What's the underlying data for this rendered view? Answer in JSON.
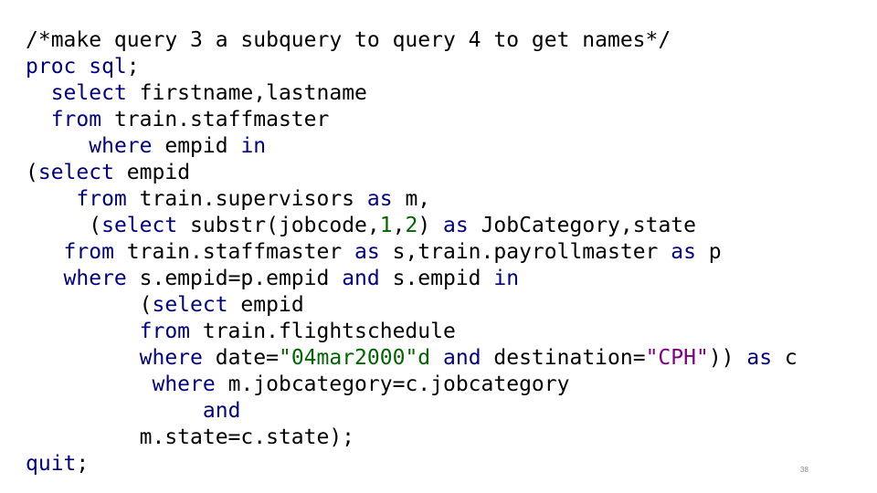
{
  "colors": {
    "keyword": "#000080",
    "string": "#800080",
    "number": "#006400",
    "text": "#000000",
    "page_number": "#8a8a8a"
  },
  "code": {
    "lines": [
      {
        "tokens": [
          {
            "text": "/*make query 3 a subquery to query 4 to get names*/",
            "type": "comment"
          }
        ]
      },
      {
        "tokens": [
          {
            "text": "proc sql",
            "type": "proc"
          },
          {
            "text": ";",
            "type": "plain"
          }
        ]
      },
      {
        "tokens": [
          {
            "text": "  ",
            "type": "plain"
          },
          {
            "text": "select",
            "type": "kw"
          },
          {
            "text": " firstname,lastname",
            "type": "plain"
          }
        ]
      },
      {
        "tokens": [
          {
            "text": "  ",
            "type": "plain"
          },
          {
            "text": "from",
            "type": "kw"
          },
          {
            "text": " train.staffmaster",
            "type": "plain"
          }
        ]
      },
      {
        "tokens": [
          {
            "text": "     ",
            "type": "plain"
          },
          {
            "text": "where",
            "type": "kw"
          },
          {
            "text": " empid ",
            "type": "plain"
          },
          {
            "text": "in",
            "type": "kw"
          }
        ]
      },
      {
        "tokens": [
          {
            "text": "(",
            "type": "plain"
          },
          {
            "text": "select",
            "type": "kw"
          },
          {
            "text": " empid",
            "type": "plain"
          }
        ]
      },
      {
        "tokens": [
          {
            "text": "    ",
            "type": "plain"
          },
          {
            "text": "from",
            "type": "kw"
          },
          {
            "text": " train.supervisors ",
            "type": "plain"
          },
          {
            "text": "as",
            "type": "kw"
          },
          {
            "text": " m,",
            "type": "plain"
          }
        ]
      },
      {
        "tokens": [
          {
            "text": "     (",
            "type": "plain"
          },
          {
            "text": "select",
            "type": "kw"
          },
          {
            "text": " substr(jobcode,",
            "type": "plain"
          },
          {
            "text": "1",
            "type": "num"
          },
          {
            "text": ",",
            "type": "plain"
          },
          {
            "text": "2",
            "type": "num"
          },
          {
            "text": ") ",
            "type": "plain"
          },
          {
            "text": "as",
            "type": "kw"
          },
          {
            "text": " JobCategory,state",
            "type": "plain"
          }
        ]
      },
      {
        "tokens": [
          {
            "text": "   ",
            "type": "plain"
          },
          {
            "text": "from",
            "type": "kw"
          },
          {
            "text": " train.staffmaster ",
            "type": "plain"
          },
          {
            "text": "as",
            "type": "kw"
          },
          {
            "text": " s,train.payrollmaster ",
            "type": "plain"
          },
          {
            "text": "as",
            "type": "kw"
          },
          {
            "text": " p",
            "type": "plain"
          }
        ]
      },
      {
        "tokens": [
          {
            "text": "   ",
            "type": "plain"
          },
          {
            "text": "where",
            "type": "kw"
          },
          {
            "text": " s.empid=p.empid ",
            "type": "plain"
          },
          {
            "text": "and",
            "type": "kw"
          },
          {
            "text": " s.empid ",
            "type": "plain"
          },
          {
            "text": "in",
            "type": "kw"
          }
        ]
      },
      {
        "tokens": [
          {
            "text": "         (",
            "type": "plain"
          },
          {
            "text": "select",
            "type": "kw"
          },
          {
            "text": " empid",
            "type": "plain"
          }
        ]
      },
      {
        "tokens": [
          {
            "text": "         ",
            "type": "plain"
          },
          {
            "text": "from",
            "type": "kw"
          },
          {
            "text": " train.flightschedule",
            "type": "plain"
          }
        ]
      },
      {
        "tokens": [
          {
            "text": "         ",
            "type": "plain"
          },
          {
            "text": "where",
            "type": "kw"
          },
          {
            "text": " date=",
            "type": "plain"
          },
          {
            "text": "\"04mar2000\"d",
            "type": "num"
          },
          {
            "text": " ",
            "type": "plain"
          },
          {
            "text": "and",
            "type": "kw"
          },
          {
            "text": " destination=",
            "type": "plain"
          },
          {
            "text": "\"CPH\"",
            "type": "str"
          },
          {
            "text": ")) ",
            "type": "plain"
          },
          {
            "text": "as",
            "type": "kw"
          },
          {
            "text": " c",
            "type": "plain"
          }
        ]
      },
      {
        "tokens": [
          {
            "text": "          ",
            "type": "plain"
          },
          {
            "text": "where",
            "type": "kw"
          },
          {
            "text": " m.jobcategory=c.jobcategory",
            "type": "plain"
          }
        ]
      },
      {
        "tokens": [
          {
            "text": "              ",
            "type": "plain"
          },
          {
            "text": "and",
            "type": "kw"
          }
        ]
      },
      {
        "tokens": [
          {
            "text": "         m.state=c.state);",
            "type": "plain"
          }
        ]
      },
      {
        "tokens": [
          {
            "text": "quit",
            "type": "proc"
          },
          {
            "text": ";",
            "type": "plain"
          }
        ]
      }
    ]
  },
  "page_number": "38"
}
